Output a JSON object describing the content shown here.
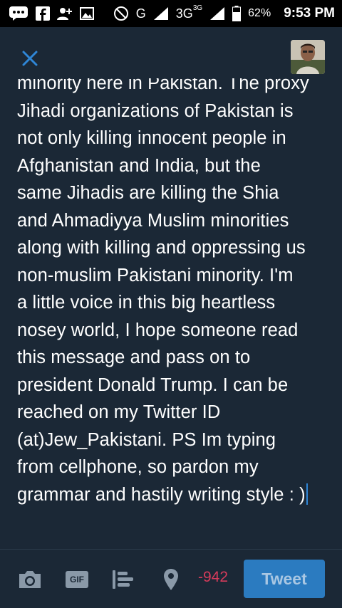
{
  "status_bar": {
    "network": "G",
    "network_2": "3G",
    "network_2_sup": "3G",
    "battery": "62%",
    "time": "9:53 PM"
  },
  "compose": {
    "text_lines": [
      "minority here in Pakistan. The proxy",
      "Jihadi organizations of Pakistan is",
      "not only killing innocent people in",
      "Afghanistan and India, but the",
      "same Jihadis are killing the Shia",
      "and Ahmadiyya Muslim minorities",
      "along with killing and oppressing us",
      "non-muslim Pakistani minority. I'm",
      "a little voice in this big heartless",
      "nosey world, I hope someone read",
      "this message and pass on to",
      "president Donald Trump. I can be",
      "reached on my Twitter ID",
      "(at)Jew_Pakistani. PS Im typing",
      "from cellphone, so pardon my",
      "grammar and hastily writing style : )"
    ]
  },
  "toolbar": {
    "gif_label": "GIF",
    "char_count": "-942",
    "tweet_label": "Tweet"
  },
  "colors": {
    "background": "#1b2836",
    "accent": "#2f86d6",
    "counter": "#d63b5b",
    "tweet_button": "#2b7bc0",
    "icon_gray": "#8a99a8"
  }
}
